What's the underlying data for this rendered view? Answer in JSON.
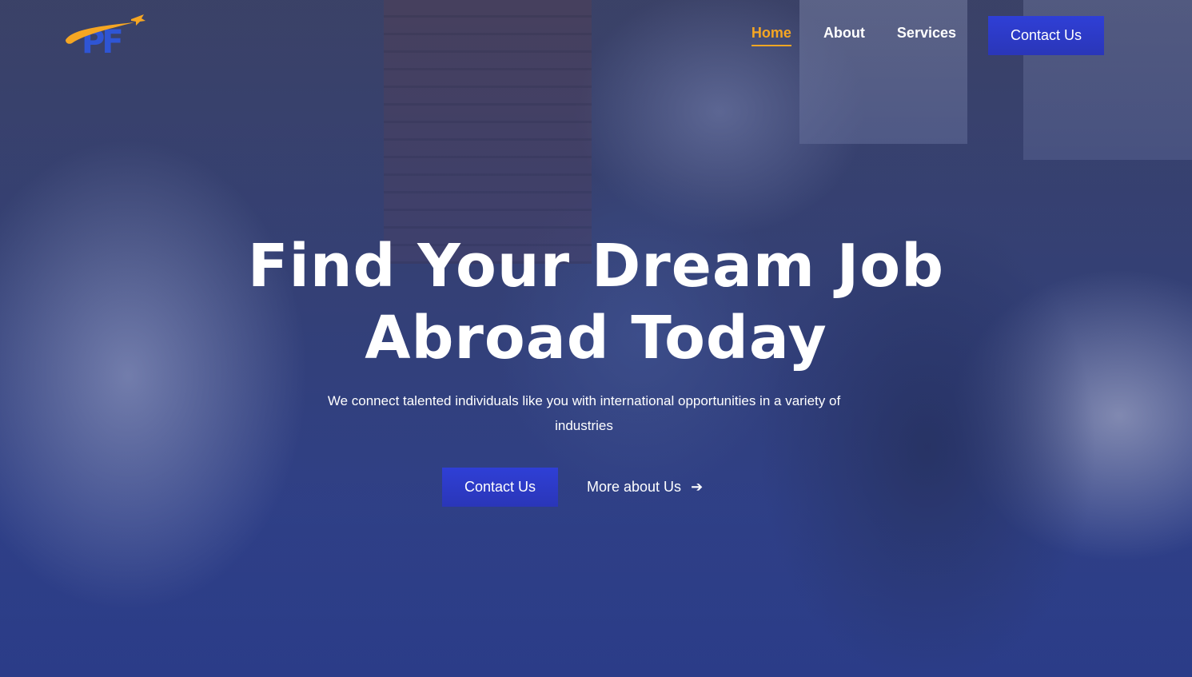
{
  "brand": {
    "logo_text": "PF",
    "logo_icon": "airplane-swoosh-logo",
    "colors": {
      "blue": "#2f55d4",
      "orange": "#f5a623"
    }
  },
  "nav": {
    "items": [
      {
        "label": "Home",
        "active": true
      },
      {
        "label": "About",
        "active": false
      },
      {
        "label": "Services",
        "active": false
      }
    ],
    "cta_label": "Contact Us"
  },
  "hero": {
    "title_line1": "Find Your Dream Job",
    "title_line2": "Abroad Today",
    "subtitle": "We connect talented individuals like you with international opportunities in a variety of industries",
    "primary_button": "Contact Us",
    "secondary_button": "More about Us",
    "secondary_icon": "arrow-right-icon"
  },
  "colors": {
    "accent": "#2f3fd6",
    "active_nav": "#f5a623",
    "text": "#ffffff"
  }
}
